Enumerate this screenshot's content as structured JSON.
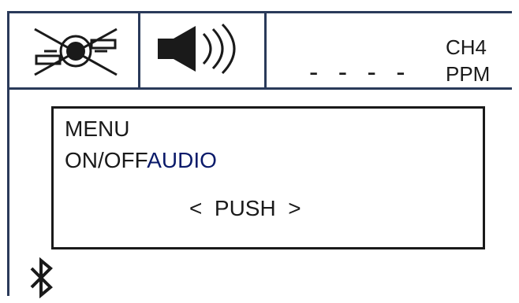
{
  "status_bar": {
    "vibration_icon": "vibration-off-icon",
    "audio_icon": "speaker-icon",
    "reading": "- - - -",
    "gas_name": "CH4",
    "gas_unit": "PPM"
  },
  "menu": {
    "title": "MENU",
    "option_label": "ON/OFF",
    "option_value": "AUDIO",
    "action": "<  PUSH  >"
  },
  "footer": {
    "connectivity_icon": "bluetooth-icon"
  },
  "colors": {
    "frame": "#2a3a5a",
    "text": "#1a1a1a",
    "highlight": "#0a1a6a"
  }
}
